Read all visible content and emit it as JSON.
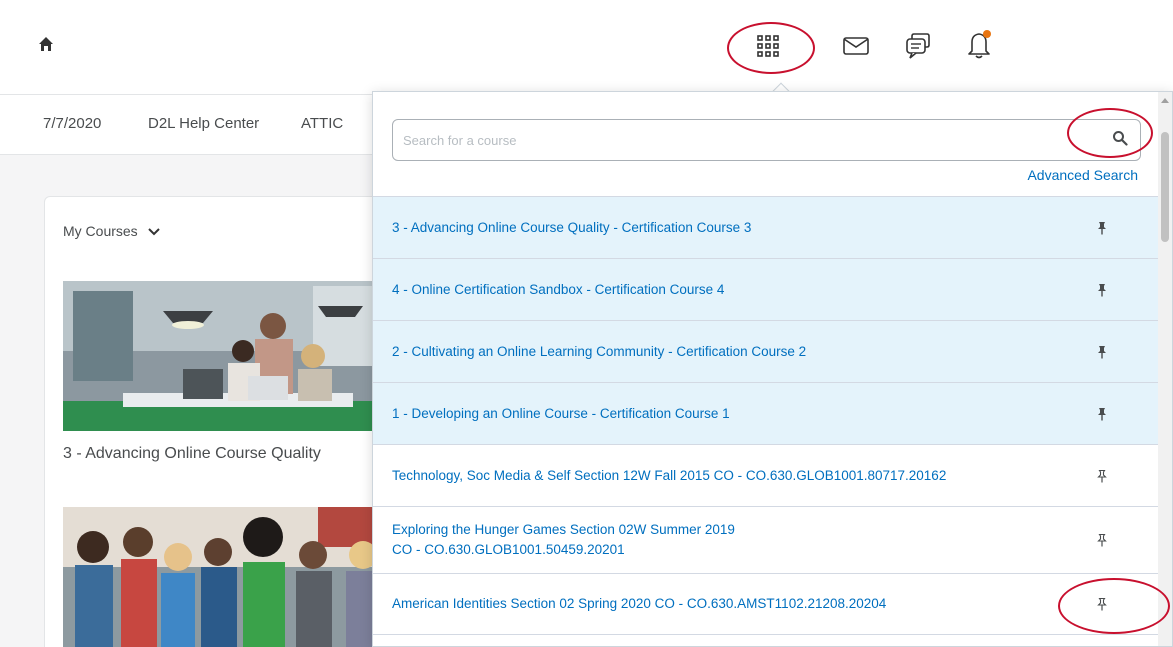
{
  "header": {
    "icons": {
      "home": "home-icon",
      "waffle": "course-selector-icon",
      "mail": "mail-icon",
      "chat": "chat-icon",
      "bell": "bell-icon"
    },
    "notification_dot_color": "#e87511"
  },
  "navbar": {
    "items": [
      "7/7/2020",
      "D2L Help Center",
      "ATTIC"
    ]
  },
  "courses_widget": {
    "title": "My Courses",
    "course1_title": "3 - Advancing Online Course Quality"
  },
  "dropdown": {
    "search_placeholder": "Search for a course",
    "advanced_search": "Advanced Search",
    "courses": [
      {
        "name": "3 - Advancing Online Course Quality - Certification Course 3",
        "pinned": true
      },
      {
        "name": "4 - Online Certification Sandbox - Certification Course 4",
        "pinned": true
      },
      {
        "name": "2 - Cultivating an Online Learning Community - Certification Course 2",
        "pinned": true
      },
      {
        "name": "1 - Developing an Online Course - Certification Course 1",
        "pinned": true
      },
      {
        "name": "Technology, Soc Media & Self Section 12W Fall 2015 CO - CO.630.GLOB1001.80717.20162",
        "pinned": false
      },
      {
        "name": "Exploring the Hunger Games Section 02W Summer 2019 CO - CO.630.GLOB1001.50459.20201",
        "pinned": false
      },
      {
        "name": "American Identities Section 02 Spring 2020 CO - CO.630.AMST1102.21208.20204",
        "pinned": false
      }
    ]
  },
  "colors": {
    "link": "#006fbf",
    "pinned_row_bg": "#e4f3fb",
    "annotation": "#c8102e"
  }
}
